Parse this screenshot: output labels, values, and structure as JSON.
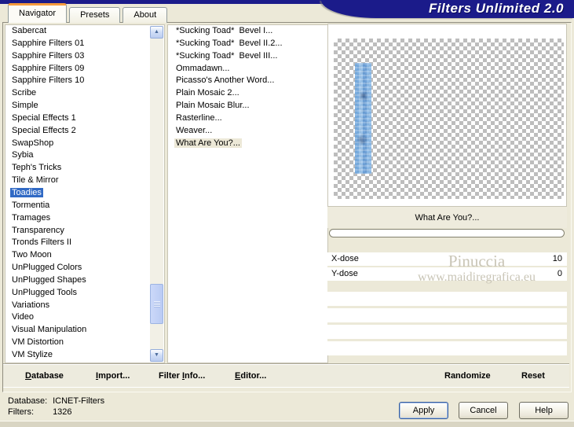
{
  "window": {
    "title": "Filters Unlimited 2.0"
  },
  "colors": {
    "banner": "#1B1B8A",
    "tab_accent": "#F59A3C",
    "selection": "#316AC5",
    "background": "#ECE9D8"
  },
  "tabs": {
    "navigator": "Navigator",
    "presets": "Presets",
    "about": "About"
  },
  "categories": {
    "items": [
      "Sabercat",
      "Sapphire Filters 01",
      "Sapphire Filters 03",
      "Sapphire Filters 09",
      "Sapphire Filters 10",
      "Scribe",
      "Simple",
      "Special Effects 1",
      "Special Effects 2",
      "SwapShop",
      "Sybia",
      "Teph's Tricks",
      "Tile & Mirror",
      "Toadies",
      "Tormentia",
      "Tramages",
      "Transparency",
      "Tronds Filters II",
      "Two Moon",
      "UnPlugged Colors",
      "UnPlugged Shapes",
      "UnPlugged Tools",
      "Variations",
      "Video",
      "Visual Manipulation",
      "VM Distortion",
      "VM Stylize"
    ],
    "selected": "Toadies"
  },
  "filters": {
    "items": [
      "*Sucking Toad*  Bevel I...",
      "*Sucking Toad*  Bevel II.2...",
      "*Sucking Toad*  Bevel III...",
      "Ommadawn...",
      "Picasso's Another Word...",
      "Plain Mosaic 2...",
      "Plain Mosaic Blur...",
      "Rasterline...",
      "Weaver...",
      "What Are You?..."
    ],
    "selected": "What Are You?..."
  },
  "icons": {
    "scroll_up": "▲",
    "scroll_down": "▼"
  },
  "controls": {
    "filter_name": "What Are You?...",
    "params": [
      {
        "name": "X-dose",
        "value": "10"
      },
      {
        "name": "Y-dose",
        "value": "0"
      }
    ],
    "randomize": "Randomize",
    "reset": "Reset"
  },
  "watermark": {
    "line1": "Pinuccia",
    "line2": "www.maidiregrafica.eu"
  },
  "toolbar": {
    "database": "Database",
    "import": "Import...",
    "filter_info": "Filter Info...",
    "editor": "Editor..."
  },
  "status": {
    "database_label": "Database:",
    "database_value": "ICNET-Filters",
    "filters_label": "Filters:",
    "filters_value": "1326"
  },
  "buttons": {
    "apply": "Apply",
    "cancel": "Cancel",
    "help": "Help"
  }
}
